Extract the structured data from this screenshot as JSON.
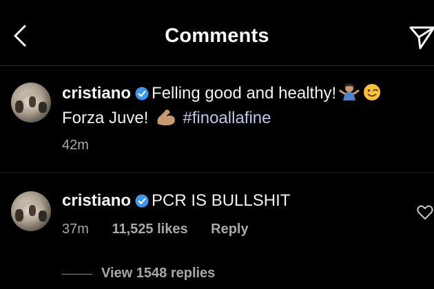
{
  "header": {
    "title": "Comments",
    "back_icon": "chevron-left-icon",
    "share_icon": "paper-plane-icon"
  },
  "caption": {
    "username": "cristiano",
    "text_part1": "Felling good and healthy!",
    "text_part2": "Forza Juve!",
    "hashtag": "#finoallafine",
    "time": "42m",
    "emojis": [
      "person-shrugging-emoji",
      "winking-face-emoji",
      "flexed-biceps-emoji"
    ]
  },
  "comments": [
    {
      "username": "cristiano",
      "text": "PCR IS BULLSHIT",
      "time": "37m",
      "likes": "11,525 likes",
      "reply_label": "Reply",
      "view_replies": "View 1548 replies"
    }
  ],
  "colors": {
    "background": "#000000",
    "verified_badge": "#3897f0",
    "hashtag": "#b8c7ea",
    "secondary_text": "#a8a8a8"
  }
}
